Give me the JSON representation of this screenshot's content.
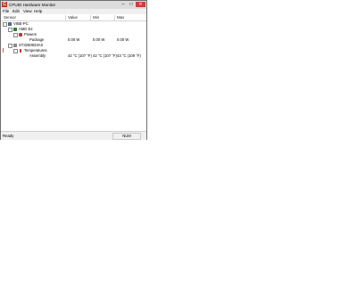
{
  "window": {
    "title": "CPUID Hardware Monitor",
    "controls": {
      "minimize": "–",
      "maximize": "□",
      "close": "✕"
    }
  },
  "menu": [
    "File",
    "Edit",
    "View",
    "Help"
  ],
  "columns": {
    "sensor": "Sensor",
    "value": "Value",
    "min": "Min",
    "max": "Max"
  },
  "tree": {
    "pc": {
      "label": "VIBE-PC"
    },
    "cpu": {
      "label": "AMD E2"
    },
    "powers": {
      "label": "Powers"
    },
    "package": {
      "label": "Package",
      "value": "0.00 W",
      "min": "0.00 W",
      "max": "0.00 W"
    },
    "drive": {
      "label": "ST3250823AS"
    },
    "temps": {
      "label": "Temperatures"
    },
    "assembly": {
      "label": "Assembly",
      "value": "42 °C (107 °F)",
      "min": "42 °C (107 °F)",
      "max": "43 °C (109 °F)"
    }
  },
  "status": {
    "left": "Ready",
    "num": "NUM"
  }
}
